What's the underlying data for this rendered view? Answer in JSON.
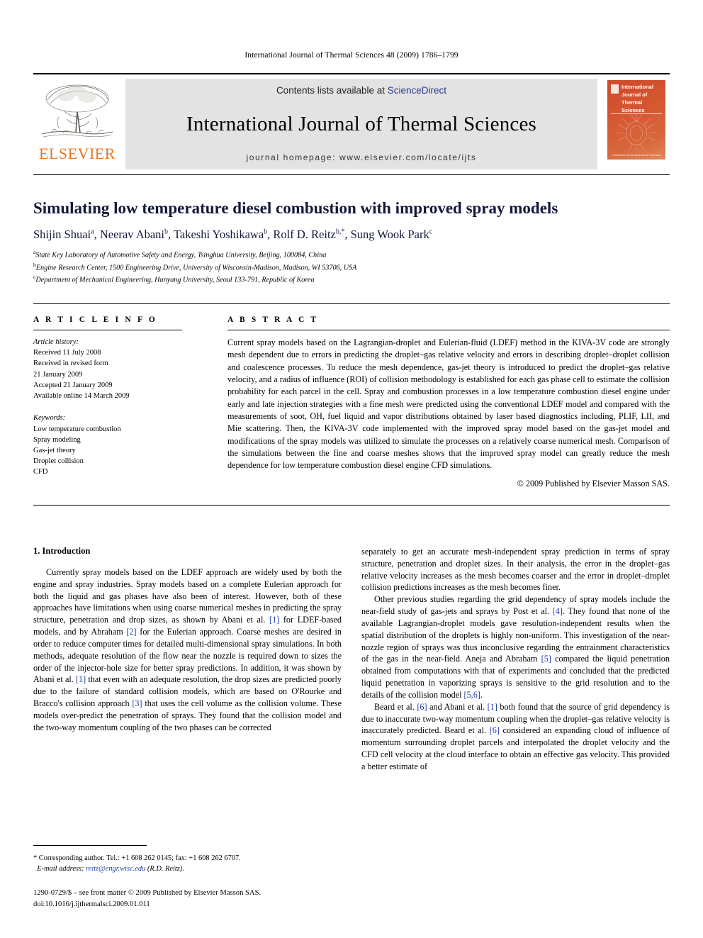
{
  "running_head": "International Journal of Thermal Sciences 48 (2009) 1786–1799",
  "masthead": {
    "publisher_name": "ELSEVIER",
    "contents_prefix": "Contents lists available at ",
    "contents_link": "ScienceDirect",
    "journal_title": "International Journal of Thermal Sciences",
    "homepage": "journal homepage: www.elsevier.com/locate/ijts",
    "cover": {
      "title": "International Journal of Thermal Sciences",
      "footer": "Founded as Revue Générale de Thermique"
    },
    "colors": {
      "band_bg": "#e3e3e3",
      "link_blue": "#2b3a8f",
      "elsevier_orange": "#E87722",
      "cover_orange": "#cf4a2a"
    }
  },
  "article": {
    "title": "Simulating low temperature diesel combustion with improved spray models",
    "authors": [
      {
        "name": "Shijin Shuai",
        "sup": "a",
        "sep": ", "
      },
      {
        "name": "Neerav Abani",
        "sup": "b",
        "sep": ", "
      },
      {
        "name": "Takeshi Yoshikawa",
        "sup": "b",
        "sep": ", "
      },
      {
        "name": "Rolf D. Reitz",
        "sup": "b,*",
        "sep": ", "
      },
      {
        "name": "Sung Wook Park",
        "sup": "c",
        "sep": ""
      }
    ],
    "affiliations": [
      {
        "mark": "a",
        "text": "State Key Laboratory of Automotive Safety and Energy, Tsinghua University, Beijing, 100084, China"
      },
      {
        "mark": "b",
        "text": "Engine Research Center, 1500 Engineering Drive, University of Wisconsin-Madison, Madison, WI 53706, USA"
      },
      {
        "mark": "c",
        "text": "Department of Mechanical Engineering, Hanyang University, Seoul 133-791, Republic of Korea"
      }
    ]
  },
  "article_info": {
    "heading": "A R T I C L E   I N F O",
    "history_label": "Article history:",
    "history": [
      "Received 11 July 2008",
      "Received in revised form",
      "21 January 2009",
      "Accepted 21 January 2009",
      "Available online 14 March 2009"
    ],
    "keywords_label": "Keywords:",
    "keywords": [
      "Low temperature combustion",
      "Spray modeling",
      "Gas-jet theory",
      "Droplet collision",
      "CFD"
    ]
  },
  "abstract": {
    "heading": "A B S T R A C T",
    "text": "Current spray models based on the Lagrangian-droplet and Eulerian-fluid (LDEF) method in the KIVA-3V code are strongly mesh dependent due to errors in predicting the droplet–gas relative velocity and errors in describing droplet–droplet collision and coalescence processes. To reduce the mesh dependence, gas-jet theory is introduced to predict the droplet–gas relative velocity, and a radius of influence (ROI) of collision methodology is established for each gas phase cell to estimate the collision probability for each parcel in the cell. Spray and combustion processes in a low temperature combustion diesel engine under early and late injection strategies with a fine mesh were predicted using the conventional LDEF model and compared with the measurements of soot, OH, fuel liquid and vapor distributions obtained by laser based diagnostics including, PLIF, LII, and Mie scattering. Then, the KIVA-3V code implemented with the improved spray model based on the gas-jet model and modifications of the spray models was utilized to simulate the processes on a relatively coarse numerical mesh. Comparison of the simulations between the fine and coarse meshes shows that the improved spray model can greatly reduce the mesh dependence for low temperature combustion diesel engine CFD simulations.",
    "copyright": "© 2009 Published by Elsevier Masson SAS."
  },
  "body": {
    "section_heading": "1. Introduction",
    "left_paragraphs": [
      "Currently spray models based on the LDEF approach are widely used by both the engine and spray industries. Spray models based on a complete Eulerian approach for both the liquid and gas phases have also been of interest. However, both of these approaches have limitations when using coarse numerical meshes in predicting the spray structure, penetration and drop sizes, as shown by Abani et al. [1] for LDEF-based models, and by Abraham [2] for the Eulerian approach. Coarse meshes are desired in order to reduce computer times for detailed multi-dimensional spray simulations. In both methods, adequate resolution of the flow near the nozzle is required down to sizes the order of the injector-hole size for better spray predictions. In addition, it was shown by Abani et al. [1] that even with an adequate resolution, the drop sizes are predicted poorly due to the failure of standard collision models, which are based on O'Rourke and Bracco's collision approach [3] that uses the cell volume as the collision volume. These models over-predict the penetration of sprays. They found that the collision model and the two-way momentum coupling of the two phases can be corrected"
    ],
    "right_paragraphs": [
      "separately to get an accurate mesh-independent spray prediction in terms of spray structure, penetration and droplet sizes. In their analysis, the error in the droplet–gas relative velocity increases as the mesh becomes coarser and the error in droplet–droplet collision predictions increases as the mesh becomes finer.",
      "Other previous studies regarding the grid dependency of spray models include the near-field study of gas-jets and sprays by Post et al. [4]. They found that none of the available Lagrangian-droplet models gave resolution-independent results when the spatial distribution of the droplets is highly non-uniform. This investigation of the near-nozzle region of sprays was thus inconclusive regarding the entrainment characteristics of the gas in the near-field. Aneja and Abraham [5] compared the liquid penetration obtained from computations with that of experiments and concluded that the predicted liquid penetration in vaporizing sprays is sensitive to the grid resolution and to the details of the collision model [5,6].",
      "Beard et al. [6] and Abani et al. [1] both found that the source of grid dependency is due to inaccurate two-way momentum coupling when the droplet–gas relative velocity is inaccurately predicted. Beard et al. [6] considered an expanding cloud of influence of momentum surrounding droplet parcels and interpolated the droplet velocity and the CFD cell velocity at the cloud interface to obtain an effective gas velocity. This provided a better estimate of"
    ]
  },
  "footnotes": {
    "corresponding": "* Corresponding author. Tel.: +1 608 262 0145; fax: +1 608 262 6707.",
    "email_label": "E-mail address:",
    "email": "reitz@engr.wisc.edu",
    "email_owner": "(R.D. Reitz).",
    "issn_line": "1290-0729/$ – see front matter © 2009 Published by Elsevier Masson SAS.",
    "doi_line": "doi:10.1016/j.ijthermalsci.2009.01.011"
  }
}
